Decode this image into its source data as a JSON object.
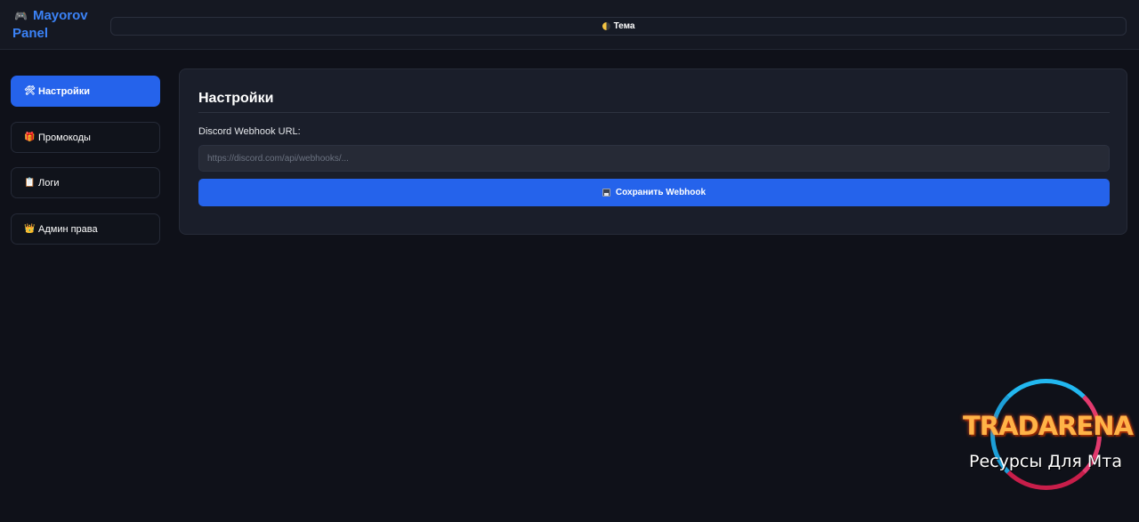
{
  "header": {
    "brand_icon": "gamepad-icon",
    "brand_line1": "Mayorov",
    "brand_line2": "Panel",
    "brand_color": "#3b82f6",
    "theme_label": "Тема"
  },
  "sidebar": {
    "items": [
      {
        "label": "Настройки",
        "icon": "tools-icon",
        "active": true
      },
      {
        "label": "Промокоды",
        "icon": "gift-icon",
        "active": false
      },
      {
        "label": "Логи",
        "icon": "clipboard-icon",
        "active": false
      },
      {
        "label": "Админ права",
        "icon": "crown-icon",
        "active": false
      }
    ]
  },
  "settings": {
    "title": "Настройки",
    "webhook_label": "Discord Webhook URL:",
    "webhook_value": "",
    "webhook_placeholder": "https://discord.com/api/webhooks/...",
    "save_label": "Сохранить Webhook",
    "accent_color": "#2563eb"
  },
  "watermark": {
    "title": "TRADARENA",
    "subtitle": "Ресурсы Для Мта"
  }
}
